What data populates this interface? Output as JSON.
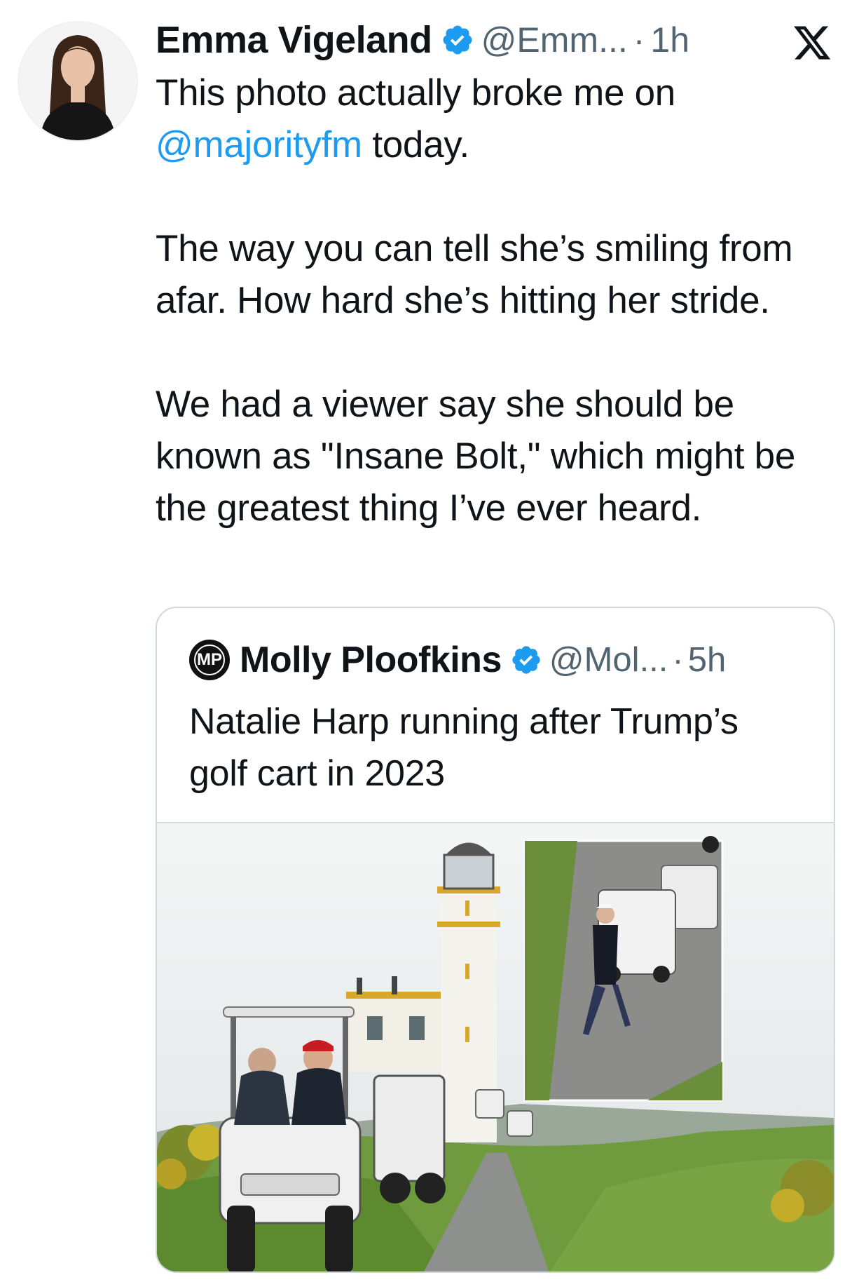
{
  "tweet": {
    "author": {
      "name": "Emma Vigeland",
      "handle": "@Emm...",
      "separator": "·",
      "time": "1h",
      "avatar_icon": "profile-photo"
    },
    "platform_icon": "x-logo-icon",
    "text": {
      "line1_prefix": "This photo actually broke me on",
      "mention": "@majorityfm",
      "line1_suffix": " today.",
      "paragraph2": "The way you can tell she’s smiling from afar. How hard she’s hitting her stride.",
      "paragraph3": "We had a viewer say she should be known as \"Insane Bolt,\" which might be the greatest thing I’ve ever heard."
    },
    "quote": {
      "avatar_initials": "MP",
      "name": "Molly Ploofkins",
      "handle": "@Mol...",
      "separator": "·",
      "time": "5h",
      "text": "Natalie Harp running after Trump’s golf cart in 2023",
      "media_icon": "golf-cart-lighthouse-photo"
    }
  },
  "colors": {
    "link": "#1d9bf0",
    "verified": "#1d9bf0",
    "secondary_text": "#536471",
    "border": "#cfd9de"
  }
}
